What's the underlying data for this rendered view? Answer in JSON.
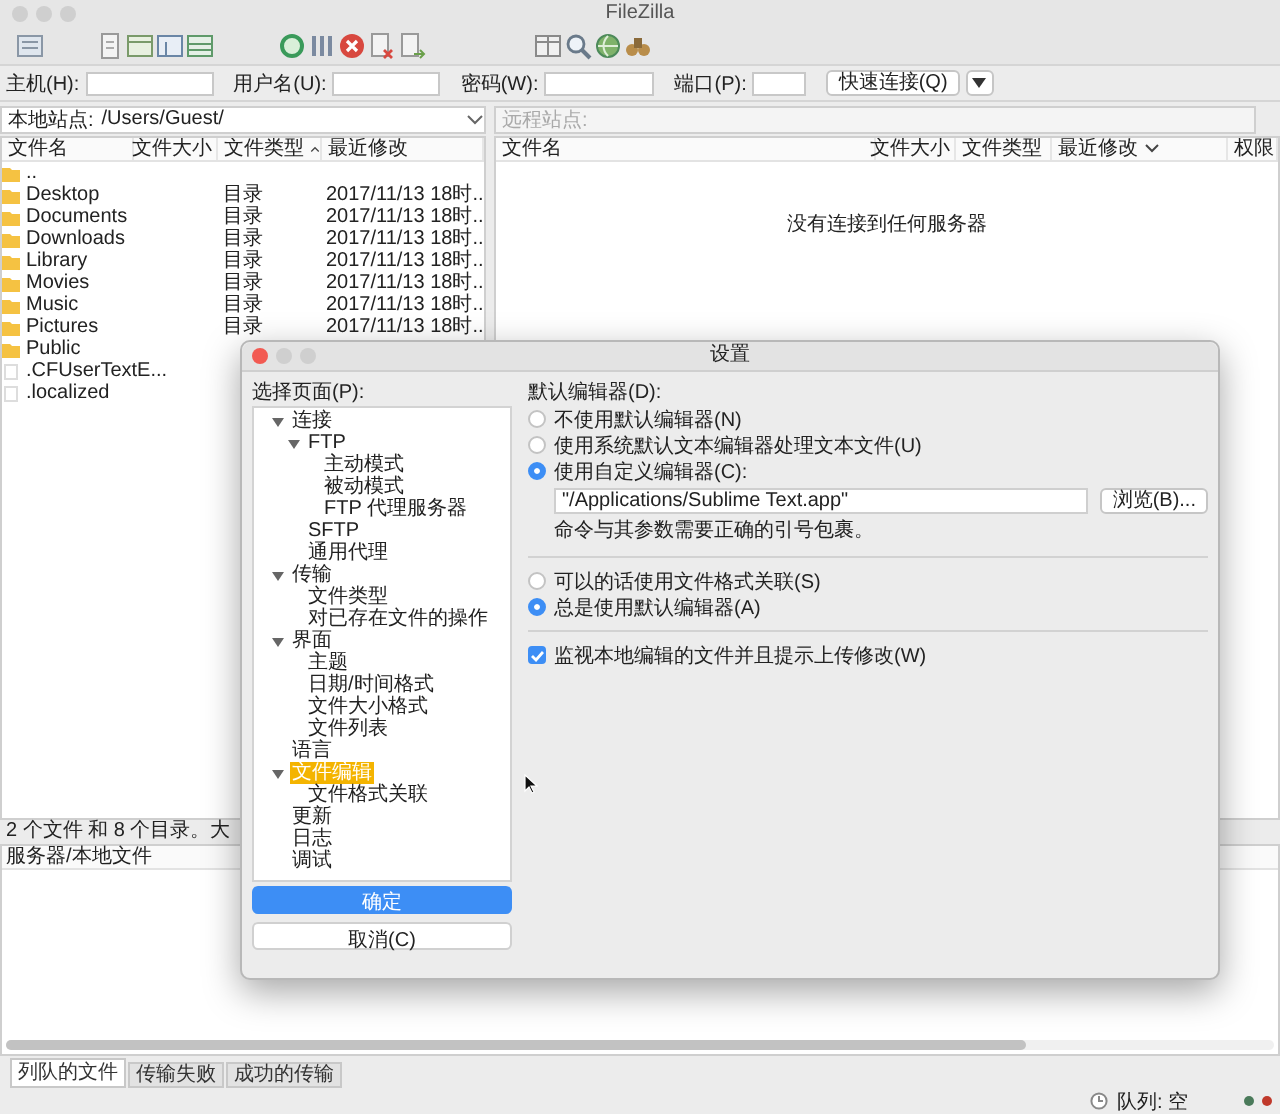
{
  "window": {
    "title": "FileZilla"
  },
  "quickconnect": {
    "fields": [
      {
        "label": "主机(H):"
      },
      {
        "label": "用户名(U):"
      },
      {
        "label": "密码(W):"
      },
      {
        "label": "端口(P):"
      }
    ],
    "button": "快速连接(Q)"
  },
  "local_site": {
    "label": "本地站点:",
    "path": "/Users/Guest/"
  },
  "remote_site": {
    "label": "远程站点:",
    "disabled": true
  },
  "local_files": {
    "columns": [
      {
        "label": "文件名",
        "sorted": false
      },
      {
        "label": "文件大小",
        "sorted": false
      },
      {
        "label": "文件类型",
        "sorted": true,
        "descending": false
      },
      {
        "label": "最近修改",
        "sorted": false
      }
    ],
    "rows": [
      {
        "kind": "folder",
        "name": ".."
      },
      {
        "kind": "folder",
        "name": "Desktop",
        "type": "目录",
        "date": "2017/11/13 18时..."
      },
      {
        "kind": "folder",
        "name": "Documents",
        "type": "目录",
        "date": "2017/11/13 18时..."
      },
      {
        "kind": "folder",
        "name": "Downloads",
        "type": "目录",
        "date": "2017/11/13 18时..."
      },
      {
        "kind": "folder",
        "name": "Library",
        "type": "目录",
        "date": "2017/11/13 18时..."
      },
      {
        "kind": "folder",
        "name": "Movies",
        "type": "目录",
        "date": "2017/11/13 18时..."
      },
      {
        "kind": "folder",
        "name": "Music",
        "type": "目录",
        "date": "2017/11/13 18时..."
      },
      {
        "kind": "folder",
        "name": "Pictures",
        "type": "目录",
        "date": "2017/11/13 18时..."
      },
      {
        "kind": "folder",
        "name": "Public"
      },
      {
        "kind": "file",
        "name": ".CFUserTextE..."
      },
      {
        "kind": "file",
        "name": ".localized"
      }
    ],
    "status": "2 个文件 和 8 个目录。大"
  },
  "remote_files": {
    "columns": [
      {
        "label": "文件名",
        "sorted": false
      },
      {
        "label": "文件大小",
        "sorted": false
      },
      {
        "label": "文件类型",
        "sorted": false
      },
      {
        "label": "最近修改",
        "sorted": true,
        "descending": true
      },
      {
        "label": "权限",
        "sorted": false
      }
    ],
    "message": "没有连接到任何服务器"
  },
  "queue": {
    "columns": [
      {
        "label": "服务器/本地文件"
      }
    ]
  },
  "queue_tabs": [
    {
      "label": "列队的文件",
      "selected": true
    },
    {
      "label": "传输失败",
      "selected": false
    },
    {
      "label": "成功的传输",
      "selected": false
    }
  ],
  "status_bar": {
    "queue": "队列: 空"
  },
  "settings_dialog": {
    "title": "设置",
    "pages_label": "选择页面(P):",
    "pages": [
      {
        "label": "连接",
        "selected": false,
        "expanded": true,
        "children": [
          {
            "label": "FTP",
            "selected": false,
            "expanded": true,
            "children": [
              {
                "label": "主动模式",
                "selected": false
              },
              {
                "label": "被动模式",
                "selected": false
              },
              {
                "label": "FTP 代理服务器",
                "selected": false
              }
            ]
          },
          {
            "label": "SFTP",
            "selected": false
          },
          {
            "label": "通用代理",
            "selected": false
          }
        ]
      },
      {
        "label": "传输",
        "selected": false,
        "expanded": true,
        "children": [
          {
            "label": "文件类型",
            "selected": false
          },
          {
            "label": "对已存在文件的操作",
            "selected": false
          }
        ]
      },
      {
        "label": "界面",
        "selected": false,
        "expanded": true,
        "children": [
          {
            "label": "主题",
            "selected": false
          },
          {
            "label": "日期/时间格式",
            "selected": false
          },
          {
            "label": "文件大小格式",
            "selected": false
          },
          {
            "label": "文件列表",
            "selected": false
          }
        ]
      },
      {
        "label": "语言",
        "selected": false
      },
      {
        "label": "文件编辑",
        "selected": true,
        "expanded": true,
        "children": [
          {
            "label": "文件格式关联",
            "selected": false
          }
        ]
      },
      {
        "label": "更新",
        "selected": false
      },
      {
        "label": "日志",
        "selected": false
      },
      {
        "label": "调试",
        "selected": false
      }
    ],
    "ok_button": "确定",
    "cancel_button": "取消(C)",
    "editor": {
      "label": "默认编辑器(D):",
      "options": [
        {
          "label": "不使用默认编辑器(N)",
          "selected": false
        },
        {
          "label": "使用系统默认文本编辑器处理文本文件(U)",
          "selected": false
        },
        {
          "label": "使用自定义编辑器(C):",
          "selected": true
        }
      ],
      "command": "\"/Applications/Sublime Text.app\"",
      "browse_button": "浏览(B)...",
      "note": "命令与其参数需要正确的引号包裹。"
    },
    "association": [
      {
        "label": "可以的话使用文件格式关联(S)",
        "selected": false
      },
      {
        "label": "总是使用默认编辑器(A)",
        "selected": true
      }
    ],
    "watch": {
      "label": "监视本地编辑的文件并且提示上传修改(W)",
      "checked": true
    }
  }
}
